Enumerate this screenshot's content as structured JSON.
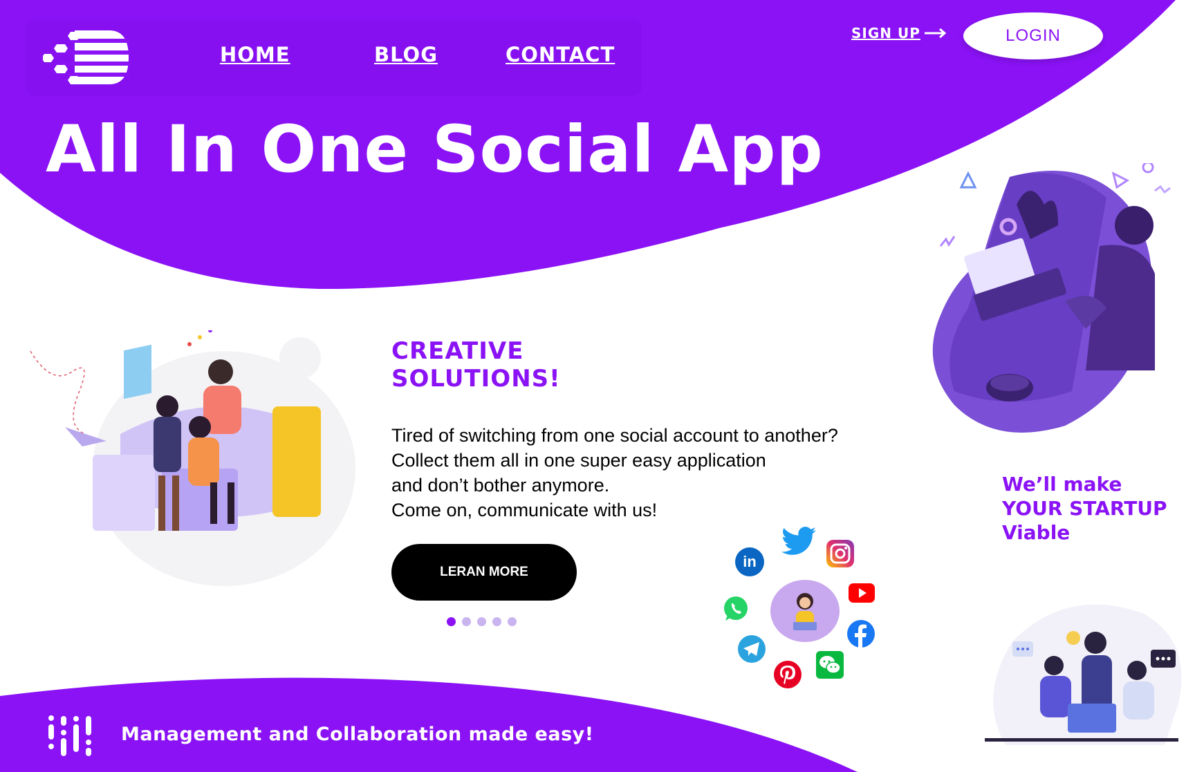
{
  "nav": {
    "home": "HOME",
    "blog": "BLOG",
    "contact": "CONTACT"
  },
  "auth": {
    "signup": "SIGN UP",
    "login": "LOGIN"
  },
  "hero": {
    "title": "All In One Social App"
  },
  "section": {
    "heading_line1": "CREATIVE",
    "heading_line2": "SOLUTIONS!",
    "desc_line1": "Tired of switching from one social account to another?",
    "desc_line2": "Collect them all in one super easy application",
    "desc_line3": "and don’t bother anymore.",
    "desc_line4": "Come on, communicate with us!",
    "cta": "LERAN MORE"
  },
  "carousel": {
    "count": 5,
    "active": 1
  },
  "startup": {
    "line1": "We’ll make",
    "line2": "YOUR STARTUP",
    "line3": "Viable"
  },
  "footer": {
    "tagline": "Management and Collaboration made easy!"
  },
  "social_icons": [
    "linkedin-icon",
    "twitter-icon",
    "instagram-icon",
    "whatsapp-icon",
    "youtube-icon",
    "facebook-icon",
    "telegram-icon",
    "pinterest-icon",
    "wechat-icon"
  ],
  "colors": {
    "brand": "#8a12f5",
    "cta_bg": "#000000",
    "text": "#000000"
  }
}
